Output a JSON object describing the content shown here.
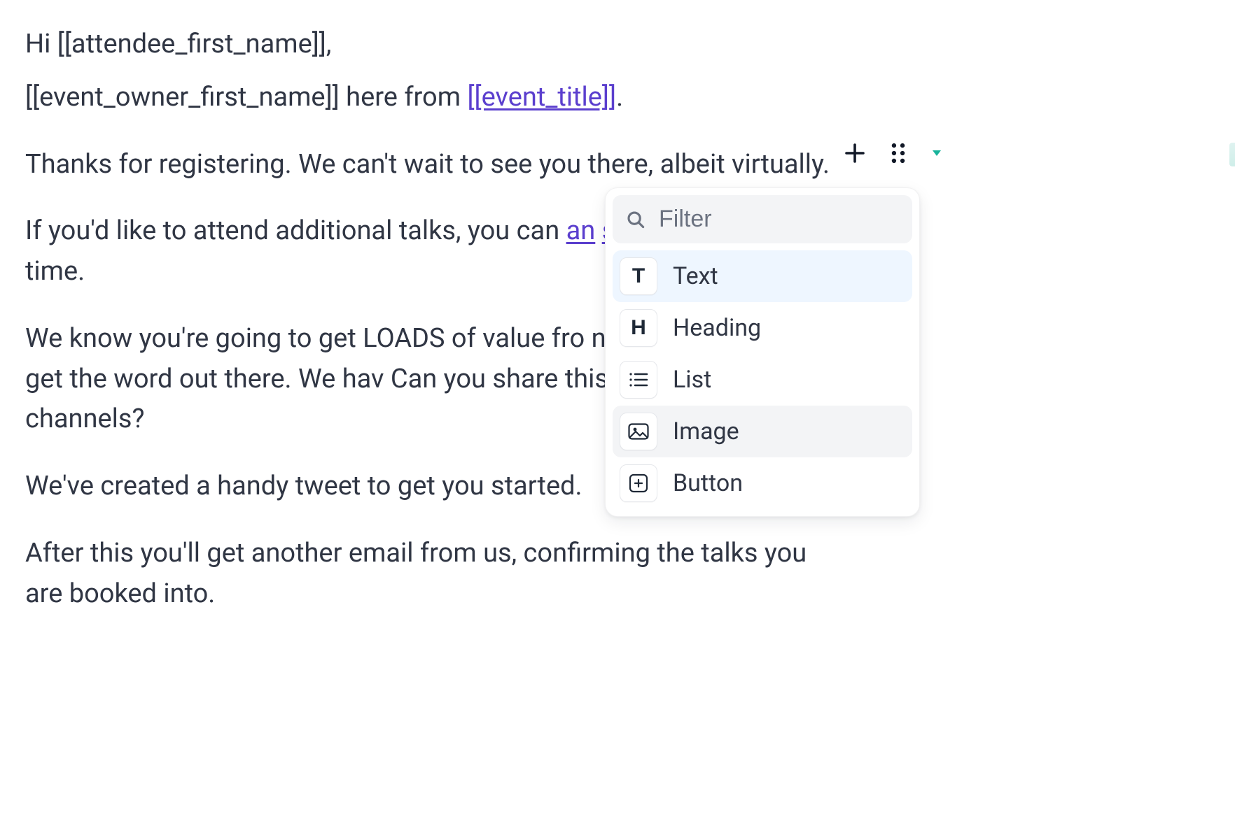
{
  "body": {
    "greeting": "Hi [[attendee_first_name]],",
    "intro_prefix": "[[event_owner_first_name]] here from ",
    "intro_link": "[[event_title]]",
    "intro_suffix": ".",
    "thanks": "Thanks for registering. We can't wait to see you there, albeit virtually.",
    "additional_prefix": "If you'd like to attend additional talks, you can ",
    "additional_link_1": "an",
    "additional_link_2": "schedule",
    "additional_suffix": " at any time.",
    "value": "We know you're going to get LOADS of value fro     need your help to get the word out there. We hav   Can you share this across your social channels?",
    "tweet": "We've created a handy tweet to get you started.",
    "after": "After this you'll get another email from us, confirming the talks you are booked into."
  },
  "popover": {
    "filter_placeholder": "Filter",
    "items": {
      "text": "Text",
      "heading": "Heading",
      "list": "List",
      "image": "Image",
      "button": "Button"
    }
  }
}
